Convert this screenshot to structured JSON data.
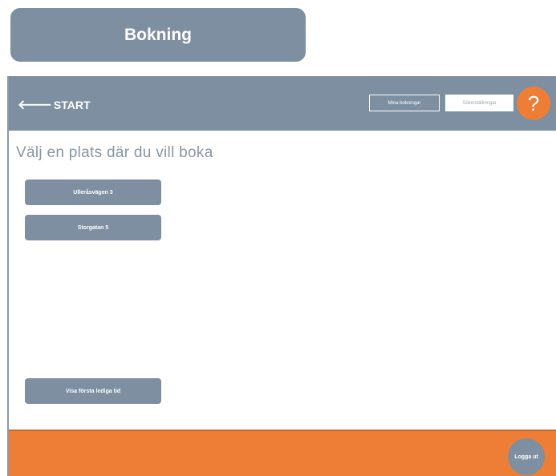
{
  "title_card": {
    "label": "Bokning"
  },
  "topbar": {
    "back_label": "START",
    "back_icon": "arrow-left-icon",
    "outline_button_label": "Mina bokningar",
    "filled_button_label": "Sökinställningar",
    "help_label": "?"
  },
  "main": {
    "heading": "Välj en plats där du vill boka",
    "locations": [
      {
        "label": "Ulleråsvägen 3"
      },
      {
        "label": "Storgatan 5"
      }
    ],
    "first_available_label": "Visa första lediga tid"
  },
  "footer": {
    "logout_label": "Logga ut"
  },
  "colors": {
    "slate": "#7d8fa1",
    "accent_orange": "#ee7e35",
    "heading_gray": "#8a96a3"
  }
}
